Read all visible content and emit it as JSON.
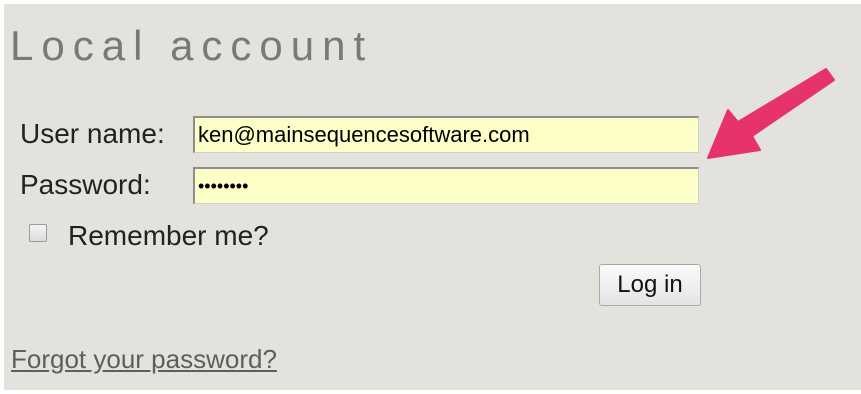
{
  "form": {
    "title": "Local account",
    "username_label": "User name:",
    "username_value": "ken@mainsequencesoftware.com",
    "password_label": "Password:",
    "password_value": "demopass",
    "remember_label": "Remember me?",
    "remember_checked": false,
    "login_label": "Log in",
    "forgot_link": "Forgot your password?"
  },
  "annotation": {
    "arrow_icon": "pink-arrow-icon",
    "arrow_color": "#e6336b"
  },
  "colors": {
    "panel_background": "#e3e2dc",
    "field_background": "#fefec8",
    "title_text": "#797979"
  }
}
